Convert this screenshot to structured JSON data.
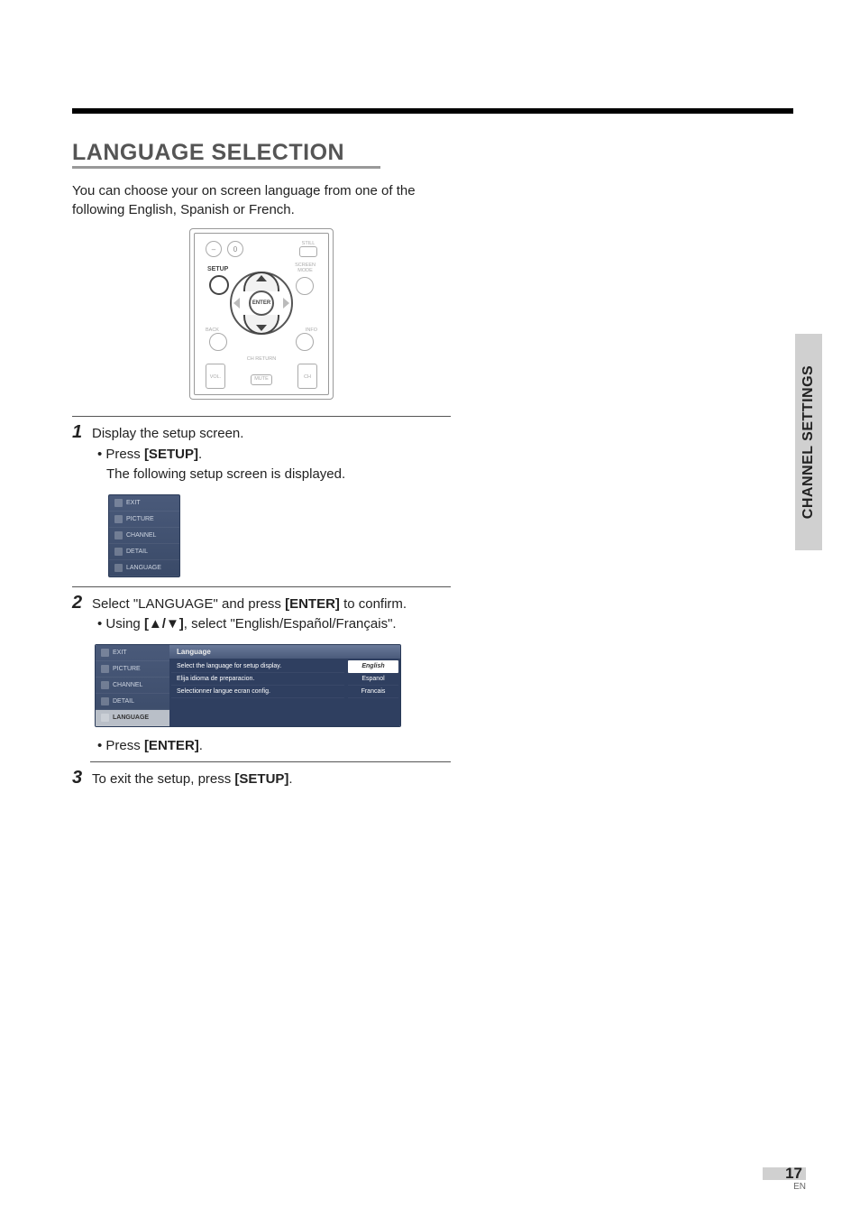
{
  "section_title": "LANGUAGE SELECTION",
  "intro_text": "You can choose your on screen language from one of the following English, Spanish or French.",
  "remote": {
    "still": "STILL",
    "setup": "SETUP",
    "screen_mode": "SCREEN\nMODE",
    "enter": "ENTER",
    "back": "BACK",
    "info": "INFO",
    "ch_return": "CH RETURN",
    "vol": "VOL.",
    "mute": "MUTE",
    "ch": "CH",
    "zero": "0",
    "dash": "–"
  },
  "step1": {
    "num": "1",
    "text": "Display the setup screen.",
    "bullet": "• Press [SETUP].",
    "bullet_after": "The following setup screen is displayed."
  },
  "menu_items": [
    "EXIT",
    "PICTURE",
    "CHANNEL",
    "DETAIL",
    "LANGUAGE"
  ],
  "step2": {
    "num": "2",
    "text": "Select \"LANGUAGE\" and press [ENTER] to confirm.",
    "bullet": "• Using [▲/▼], select \"English/Español/Français\"."
  },
  "wide_menu": {
    "header": "Language",
    "desc": [
      "Select the language for setup display.",
      "Elija idioma de preparacion.",
      "Selectionner langue ecran config."
    ],
    "options": [
      "English",
      "Espanol",
      "Francais"
    ]
  },
  "press_enter": "• Press [ENTER].",
  "step3": {
    "num": "3",
    "text": "To exit the setup, press [SETUP]."
  },
  "side_tab": "CHANNEL SETTINGS",
  "page_number": "17",
  "page_lang": "EN"
}
